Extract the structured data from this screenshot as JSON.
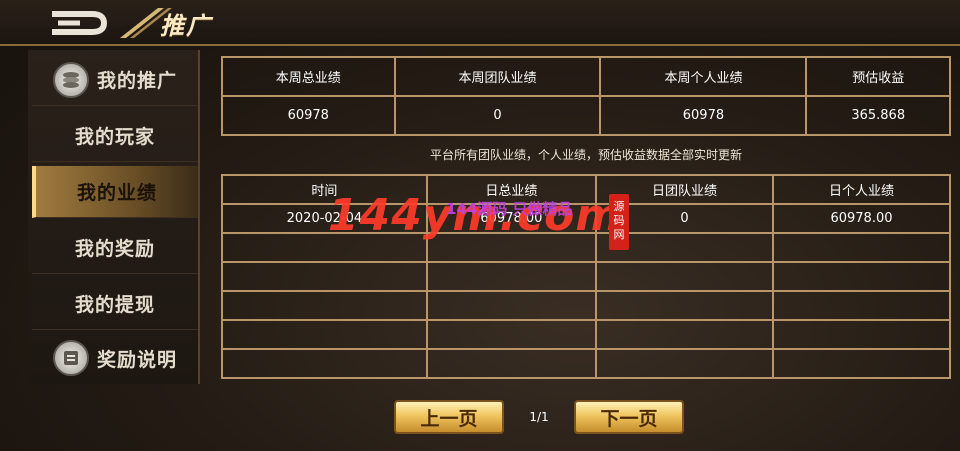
{
  "header": {
    "title": "推广"
  },
  "sidebar": {
    "items": [
      {
        "label": "我的推广",
        "icon": "coin-stack-icon",
        "active": false
      },
      {
        "label": "我的玩家",
        "icon": null,
        "active": false
      },
      {
        "label": "我的业绩",
        "icon": null,
        "active": true
      },
      {
        "label": "我的奖励",
        "icon": null,
        "active": false
      },
      {
        "label": "我的提现",
        "icon": null,
        "active": false
      },
      {
        "label": "奖励说明",
        "icon": "document-icon",
        "active": false
      }
    ]
  },
  "stats": {
    "headers": [
      "本周总业绩",
      "本周团队业绩",
      "本周个人业绩",
      "预估收益"
    ],
    "values": [
      "60978",
      "0",
      "60978",
      "365.868"
    ]
  },
  "notice": "平台所有团队业绩，个人业绩，预估收益数据全部实时更新",
  "list": {
    "headers": [
      "时间",
      "日总业绩",
      "日团队业绩",
      "日个人业绩"
    ],
    "rows": [
      [
        "2020-02-04",
        "60978.00",
        "0",
        "60978.00"
      ]
    ],
    "empty_rows": 5
  },
  "watermark": {
    "main": "144ym.com",
    "sub": "144源码 只做精品",
    "stamp": "源码网"
  },
  "pagination": {
    "prev_label": "上一页",
    "next_label": "下一页",
    "page": "1/1"
  },
  "colors": {
    "accent_gold": "#f0c55f",
    "table_border": "#b9966a",
    "watermark_red": "#ff3b2a"
  }
}
